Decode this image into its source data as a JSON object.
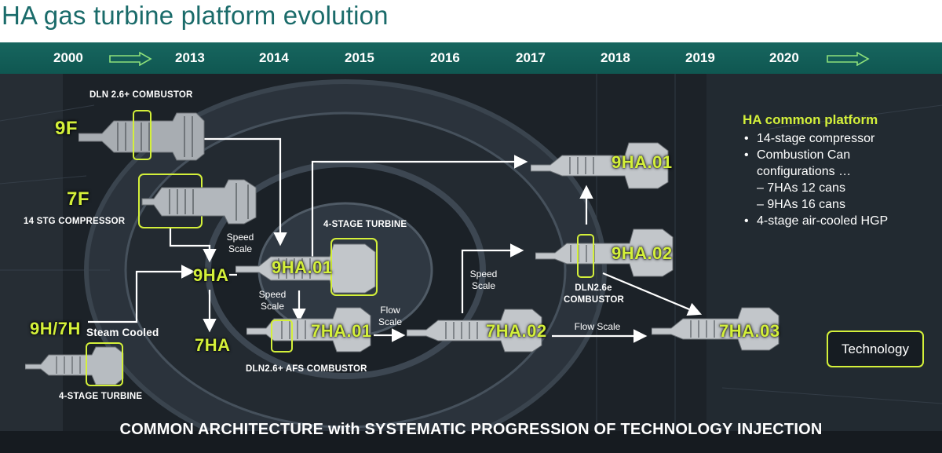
{
  "title": "HA gas turbine platform evolution",
  "timeline": {
    "years": [
      "2000",
      "2013",
      "2014",
      "2015",
      "2016",
      "2017",
      "2018",
      "2019",
      "2020"
    ]
  },
  "models": {
    "9f": "9F",
    "7f": "7F",
    "9h7h": "9H/7H",
    "9ha": "9HA",
    "7ha": "7HA",
    "9ha01_a": "9HA.01",
    "7ha01": "7HA.01",
    "7ha02": "7HA.02",
    "9ha01_b": "9HA.01",
    "9ha02": "9HA.02",
    "7ha03": "7HA.03"
  },
  "labels": {
    "dln26plus": "DLN 2.6+ COMBUSTOR",
    "stg_compressor": "14 STG COMPRESSOR",
    "steam_cooled": "Steam Cooled",
    "four_stage_left": "4-STAGE TURBINE",
    "four_stage_mid": "4-STAGE TURBINE",
    "dln26afs": "DLN2.6+ AFS COMBUSTOR",
    "dln26e_line1": "DLN2.6e",
    "dln26e_line2": "COMBUSTOR"
  },
  "scale_labels": {
    "speed_scale_1": [
      "Speed",
      "Scale"
    ],
    "speed_scale_2": [
      "Speed",
      "Scale"
    ],
    "speed_scale_3": [
      "Speed",
      "Scale"
    ],
    "flow_scale_1": [
      "Flow",
      "Scale"
    ],
    "flow_scale_2": "Flow Scale"
  },
  "platform_panel": {
    "heading": "HA common platform",
    "bullet_char": "•",
    "items": [
      {
        "text": "14-stage compressor",
        "sub": false
      },
      {
        "text": "Combustion Can",
        "sub": false
      },
      {
        "text": "configurations …",
        "sub": false,
        "continuation": true
      },
      {
        "text": "– 7HAs 12 cans",
        "sub": true
      },
      {
        "text": "– 9HAs 16 cans",
        "sub": true
      },
      {
        "text": "4-stage air-cooled HGP",
        "sub": false
      }
    ]
  },
  "legend_box": "Technology",
  "footer": "COMMON ARCHITECTURE with SYSTEMATIC PROGRESSION OF TECHNOLOGY INJECTION",
  "colors": {
    "accent": "#d4f03a",
    "timeline_bg": "#17665f",
    "title": "#1a6b6a"
  }
}
